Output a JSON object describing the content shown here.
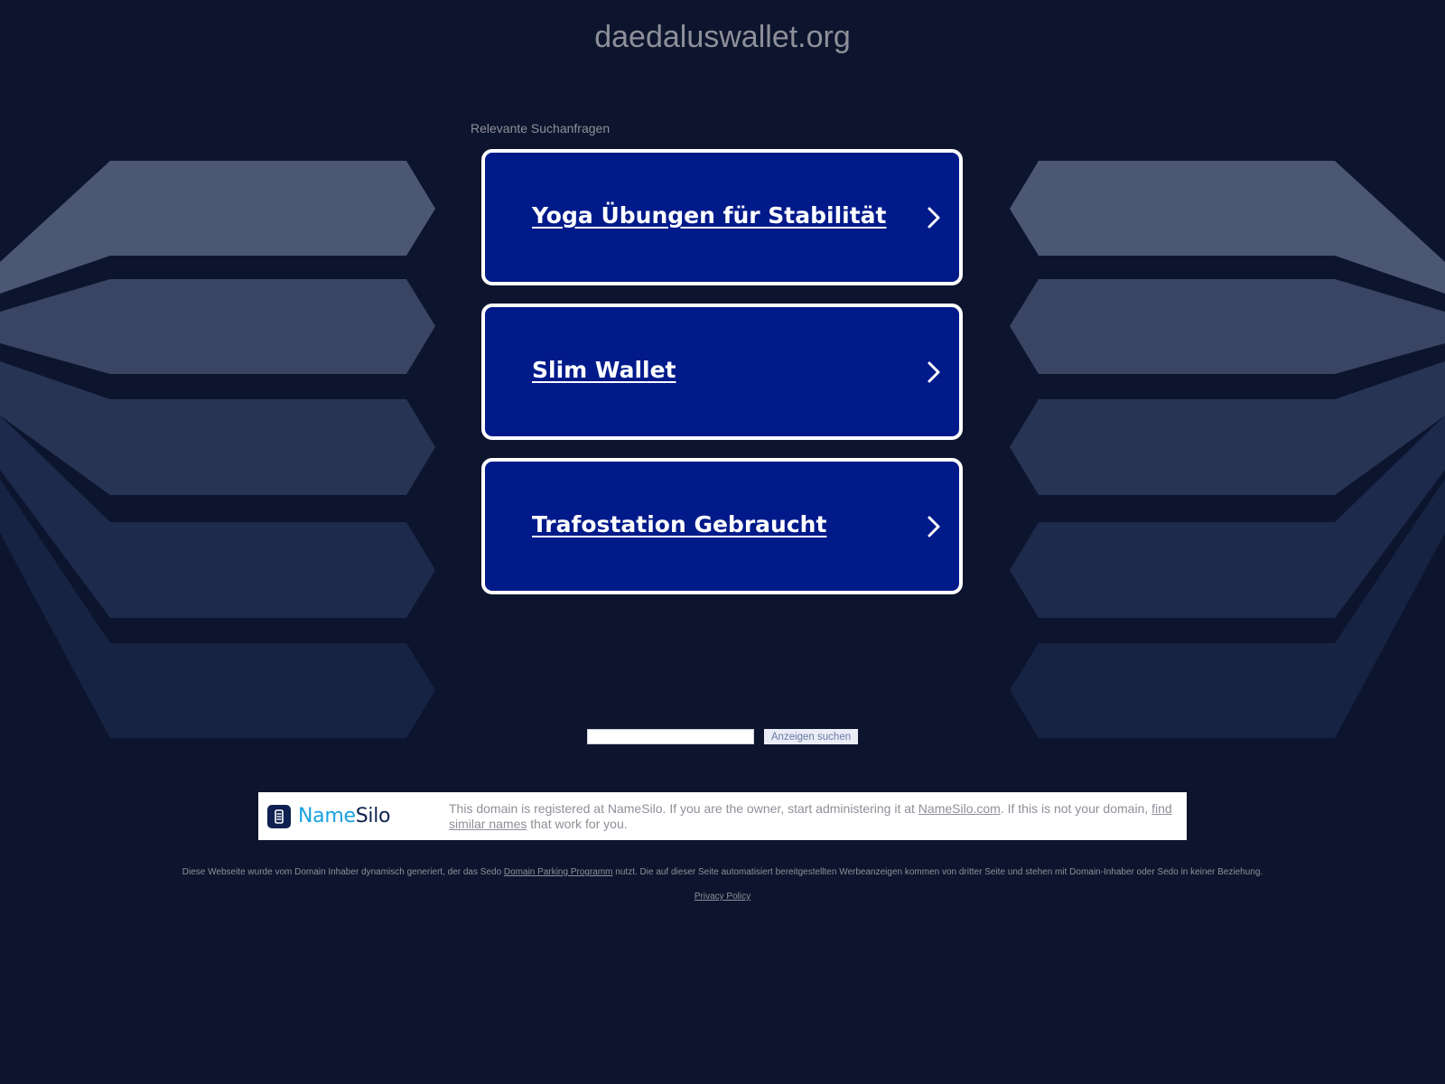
{
  "page": {
    "domain": "daedaluswallet.org",
    "related_label": "Relevante Suchanfragen"
  },
  "results": [
    {
      "label": "Yoga Übungen für Stabilität"
    },
    {
      "label": "Slim Wallet"
    },
    {
      "label": "Trafostation Gebraucht"
    }
  ],
  "search": {
    "input_value": "",
    "button_label": "Anzeigen suchen"
  },
  "registrar": {
    "logo_part1": "Name",
    "logo_part2": "Silo",
    "text_1": "This domain is registered at NameSilo. If you are the owner, start administering it at ",
    "link_1": "NameSilo.com",
    "text_2": ". If this is not your domain, ",
    "link_2": "find similar names",
    "text_3": " that work for you."
  },
  "footer": {
    "disclaimer_1": "Diese Webseite wurde vom Domain Inhaber dynamisch generiert, der das Sedo ",
    "disclaimer_link": "Domain Parking Programm",
    "disclaimer_2": " nutzt. Die auf dieser Seite automatisiert bereitgestellten Werbeanzeigen kommen von dritter Seite und stehen mit Domain-Inhaber oder Sedo in keiner Beziehung.",
    "privacy_label": "Privacy Policy"
  },
  "colors": {
    "background": "#0d152e",
    "card_fill": "#011a8a",
    "card_border": "#ffffff",
    "muted_text": "#8e9099",
    "namesilo_blue": "#1aa1e0",
    "namesilo_navy": "#0e2150"
  },
  "icons": {
    "result_chevron": "chevron-right-icon",
    "namesilo_logo": "namesilo-logo-icon"
  }
}
